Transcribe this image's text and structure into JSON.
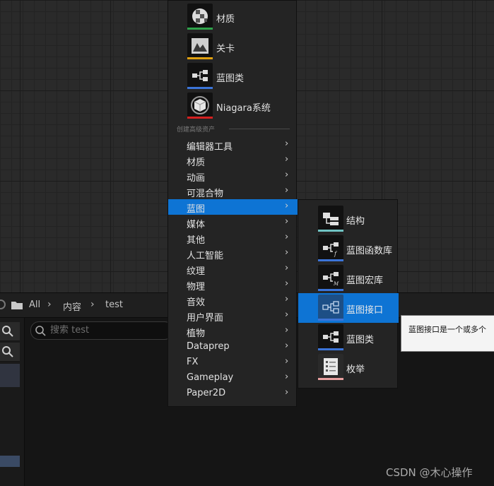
{
  "menu": {
    "common_assets": [
      {
        "label": "材质",
        "icon": "material-sphere-icon",
        "color": "#2fa34a"
      },
      {
        "label": "关卡",
        "icon": "level-mountain-icon",
        "color": "#e0a010"
      },
      {
        "label": "蓝图类",
        "icon": "blueprint-class-icon",
        "color": "#3b74d8"
      },
      {
        "label": "Niagara系统",
        "icon": "niagara-cube-icon",
        "color": "#d42020"
      }
    ],
    "section_header": "创建高级资产",
    "categories": [
      {
        "label": "编辑器工具"
      },
      {
        "label": "材质"
      },
      {
        "label": "动画"
      },
      {
        "label": "可混合物"
      },
      {
        "label": "蓝图",
        "active": true
      },
      {
        "label": "媒体"
      },
      {
        "label": "其他"
      },
      {
        "label": "人工智能"
      },
      {
        "label": "纹理"
      },
      {
        "label": "物理"
      },
      {
        "label": "音效"
      },
      {
        "label": "用户界面"
      },
      {
        "label": "植物"
      },
      {
        "label": "Dataprep"
      },
      {
        "label": "FX"
      },
      {
        "label": "Gameplay"
      },
      {
        "label": "Paper2D"
      }
    ],
    "chevron": "›"
  },
  "submenu": {
    "items": [
      {
        "label": "结构",
        "icon": "struct-icon",
        "color": "#6fc3c3"
      },
      {
        "label": "蓝图函数库",
        "icon": "function-library-icon",
        "color": "#3b74d8"
      },
      {
        "label": "蓝图宏库",
        "icon": "macro-library-icon",
        "color": "#3b74d8"
      },
      {
        "label": "蓝图接口",
        "icon": "interface-icon",
        "color": "#3b74d8",
        "active": true
      },
      {
        "label": "蓝图类",
        "icon": "blueprint-class-icon",
        "color": "#3b74d8"
      },
      {
        "label": "枚举",
        "icon": "enum-list-icon",
        "color": "#e8a0a0"
      }
    ]
  },
  "tooltip": {
    "text": "蓝图接口是一个或多个"
  },
  "content_browser": {
    "breadcrumb": [
      "All",
      "内容",
      "test"
    ],
    "search_placeholder": "搜索 test"
  },
  "watermark": "CSDN @木心操作",
  "colors": {
    "accent": "#0e74d4",
    "menu_bg": "#242424",
    "viewport_bg": "#2a2a2a"
  }
}
